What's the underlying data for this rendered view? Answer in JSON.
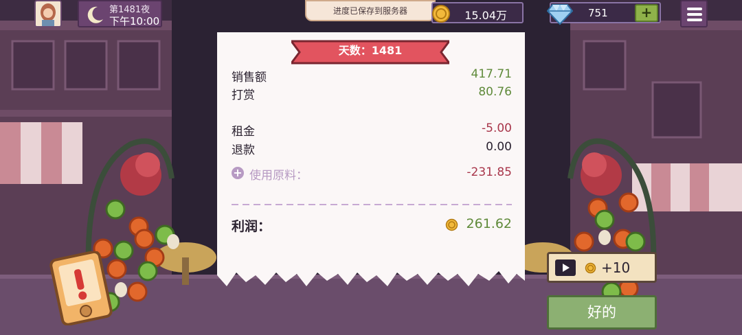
{
  "top_bar": {
    "night_label": "第1481夜",
    "clock": "下午10:00",
    "toast": "进度已保存到服务器",
    "coins": "15.04万",
    "gems": "751",
    "gem_plus": "+"
  },
  "receipt": {
    "day_banner": "天数：1481",
    "rows": [
      {
        "label": "销售额",
        "value": "417.71"
      },
      {
        "label": "打赏",
        "value": "80.76"
      },
      {
        "label": "租金",
        "value": "-5.00"
      },
      {
        "label": "退款",
        "value": "0.00"
      },
      {
        "label": "使用原料：",
        "value": "-231.85"
      }
    ],
    "profit_label": "利润：",
    "profit_value": "261.62"
  },
  "buttons": {
    "ad_reward": "+10",
    "ok": "好的"
  },
  "colors": {
    "positive": "#5f8a3a",
    "negative": "#a8354a",
    "banner_red": "#e2545f",
    "ok_green": "#8cb072"
  },
  "icons": [
    "avatar",
    "moon-icon",
    "coin-icon",
    "diamond-icon",
    "menu-icon",
    "plus-circle-icon",
    "play-icon",
    "alert-icon"
  ]
}
